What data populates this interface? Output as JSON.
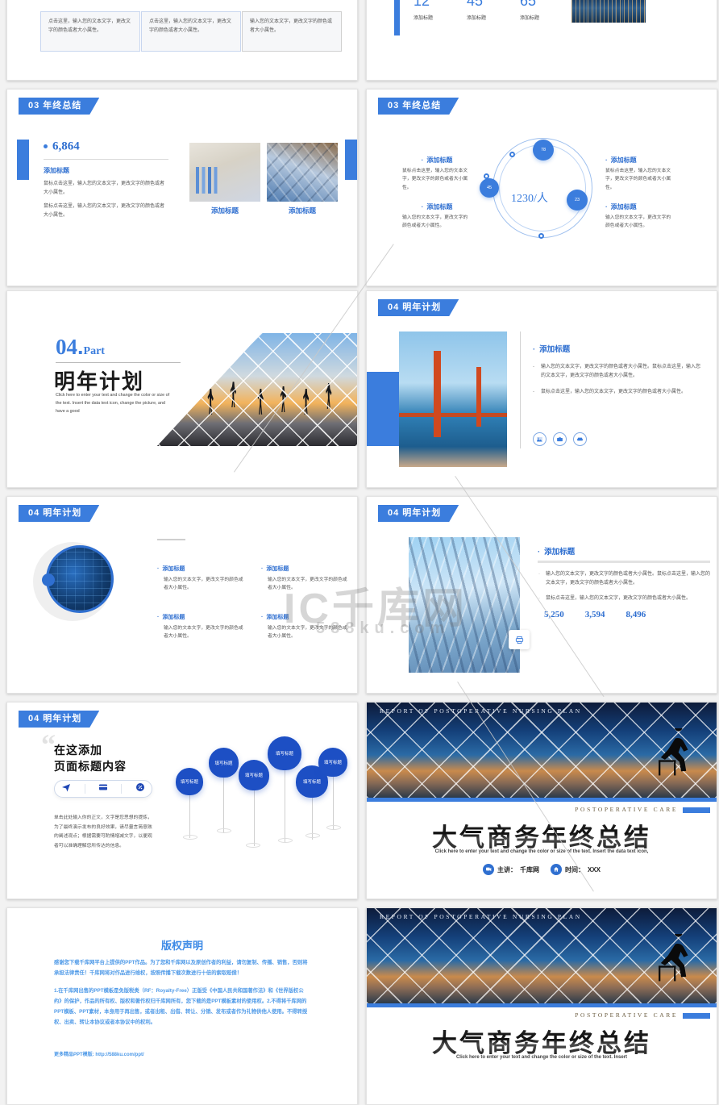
{
  "meta": {
    "accent": "#3b7ddd",
    "accent_dark": "#1d4fc4",
    "text_blue": "#2f6fd0"
  },
  "watermark": {
    "line1": "IC千库网",
    "line2": "588ku.com"
  },
  "slides": [
    {
      "id": "s1-partial-three-boxes",
      "boxes": [
        "点击这里，输入您的文本文字，更改文字的颜色或者大小属性。",
        "点击这里，输入您的文本文字，更改文字的颜色或者大小属性。",
        "输入您的文本文字，更改文字的颜色或者大小属性。"
      ]
    },
    {
      "id": "s2-partial-stats",
      "stats": [
        {
          "value": "12",
          "label": "添加标题"
        },
        {
          "value": "45",
          "label": "添加标题"
        },
        {
          "value": "65",
          "label": "添加标题"
        }
      ]
    },
    {
      "id": "s3-kpi",
      "tag_num": "03",
      "tag_text": "年终总结",
      "kpi_value": "6,864",
      "kpi_title": "添加标题",
      "kpi_paras": [
        "鼠标点击这里，输入您的文本文字，更改文字的颜色或者大小属性。",
        "鼠标点击这里，输入您的文本文字，更改文字的颜色或者大小属性。"
      ],
      "captions": [
        "添加标题",
        "添加标题"
      ]
    },
    {
      "id": "s4-circle",
      "tag_num": "03",
      "tag_text": "年终总结",
      "center_value": "1230/人",
      "nodes": [
        "78",
        "45",
        "23"
      ],
      "blocks": [
        {
          "title": "添加标题",
          "text": "鼠标点击这里，输入您的文本文字，更改文字的颜色或者大小属性。"
        },
        {
          "title": "添加标题",
          "text": "输入您的文本文字，更改文字的颜色或者大小属性。"
        },
        {
          "title": "添加标题",
          "text": "鼠标点击这里，输入您的文本文字，更改文字的颜色或者大小属性。"
        },
        {
          "title": "添加标题",
          "text": "输入您的文本文字，更改文字的颜色或者大小属性。"
        }
      ]
    },
    {
      "id": "s5-part-cover",
      "part_num": "04",
      "part_dot": ".",
      "part_word": "Part",
      "part_zh": "明年计划",
      "part_en": "Click here to enter your text and change the color or size of the text. Insert the data text icon, change the picture, and have a good"
    },
    {
      "id": "s6-bridge",
      "tag_num": "04",
      "tag_text": "明年计划",
      "heading": "添加标题",
      "items": [
        "输入您的文本文字，更改文字的颜色或者大小属性。鼠标点击这里，输入您的文本文字，更改文字的颜色或者大小属性。",
        "鼠标点击这里，输入您的文本文字，更改文字的颜色或者大小属性。"
      ],
      "icons": [
        "image-icon",
        "briefcase-icon",
        "sofa-icon"
      ]
    },
    {
      "id": "s7-circle-photo",
      "tag_num": "04",
      "tag_text": "明年计划",
      "quads": [
        {
          "title": "添加标题",
          "text": "输入您的文本文字，更改文字的颜色或者大小属性。"
        },
        {
          "title": "添加标题",
          "text": "输入您的文本文字，更改文字的颜色或者大小属性。"
        },
        {
          "title": "添加标题",
          "text": "输入您的文本文字，更改文字的颜色或者大小属性。"
        },
        {
          "title": "添加标题",
          "text": "输入您的文本文字，更改文字的颜色或者大小属性。"
        }
      ]
    },
    {
      "id": "s8-skyline",
      "tag_num": "04",
      "tag_text": "明年计划",
      "heading": "添加标题",
      "items": [
        "输入您的文本文字，更改文字的颜色或者大小属性。鼠标点击这里，输入您的文本文字，更改文字的颜色或者大小属性。",
        "鼠标点击这里，输入您的文本文字，更改文字的颜色或者大小属性。"
      ],
      "numbers": [
        "5,250",
        "3,594",
        "8,496"
      ]
    },
    {
      "id": "s9-balloons",
      "tag_num": "04",
      "tag_text": "明年计划",
      "quote_mark": "“",
      "title_line1": "在这添加",
      "title_line2": "页面标题内容",
      "pill_icons": [
        "send-icon",
        "card-icon",
        "percent-icon"
      ],
      "body": "单击此处输入你的正文，文字是您思想的提炼，为了最终演示发布的良好效果，请尽量言简意赅的阐述观点；根据需要可酌情增减文字，以便观者可以准确理解您所传达的信息。",
      "balloons": [
        "填写标题",
        "填写标题",
        "填写标题",
        "填写标题",
        "填写标题",
        "填写标题"
      ]
    },
    {
      "id": "s10-cover",
      "eyebrow": "REPORT OF POSTOPERATIVE NURSING PLAN",
      "care": "POSTOPERATIVE CARE",
      "title": "大气商务年终总结",
      "subtitle": "Click here to enter your text and change the color or size of the text. Insert the data text icon,",
      "speaker_label": "主讲：",
      "speaker_value": "千库网",
      "time_label": "时间：",
      "time_value": "XXX"
    },
    {
      "id": "s11-copyright",
      "title": "版权声明",
      "p1": "感谢您下载千库网平台上提供的PPT作品。为了您和千库网以及原创作者的利益，请勿复制、传播、销售，否则将承担法律责任！千库网将对作品进行维权，按照传播下载次数进行十倍的索取赔偿！",
      "p2": "1.在千库网出售的PPT模板是免版税类（RF：Royalty-Free）正版受《中国人民共和国著作法》和《世界版权公约》的保护，作品的所有权、版权和著作权归千库网所有，您下载的是PPT模板素材的使用权。2.不得将千库网的PPT模板、PPT素材，本身用于再出售，或者出租、出借、转让、分销、发布或者作为礼物供他人使用。不得转授权、出卖、转让本协议或者本协议中的权利。",
      "link": "更多精品PPT模版: http://588ku.com/ppt/"
    },
    {
      "id": "s12-cover",
      "eyebrow": "REPORT OF POSTOPERATIVE NURSING PLAN",
      "care": "POSTOPERATIVE CARE",
      "title": "大气商务年终总结",
      "subtitle": "Click here to enter your text and change the color or size of the text. Insert"
    }
  ]
}
